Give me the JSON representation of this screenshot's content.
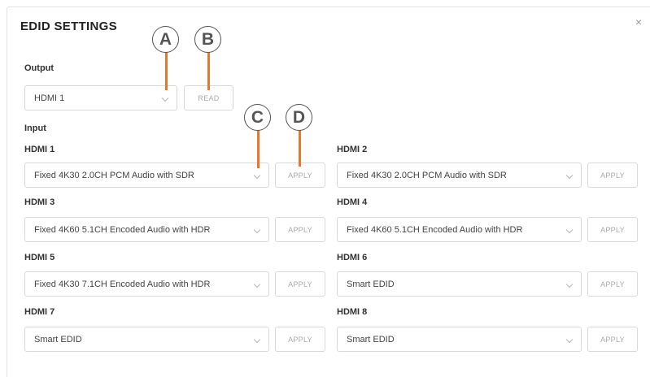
{
  "dialog": {
    "title": "EDID SETTINGS",
    "close_glyph": "×"
  },
  "output": {
    "label": "Output",
    "select_value": "HDMI 1",
    "read_label": "READ"
  },
  "input": {
    "label": "Input",
    "apply_label": "APPLY",
    "ports": [
      {
        "name": "HDMI 1",
        "value": "Fixed 4K30 2.0CH PCM Audio with SDR"
      },
      {
        "name": "HDMI 2",
        "value": "Fixed 4K30 2.0CH PCM Audio with SDR"
      },
      {
        "name": "HDMI 3",
        "value": "Fixed 4K60 5.1CH Encoded Audio with HDR"
      },
      {
        "name": "HDMI 4",
        "value": "Fixed 4K60 5.1CH Encoded Audio with HDR"
      },
      {
        "name": "HDMI 5",
        "value": "Fixed 4K30 7.1CH Encoded Audio with HDR"
      },
      {
        "name": "HDMI 6",
        "value": "Smart EDID"
      },
      {
        "name": "HDMI 7",
        "value": "Smart EDID"
      },
      {
        "name": "HDMI 8",
        "value": "Smart EDID"
      }
    ]
  },
  "callouts": {
    "a": "A",
    "b": "B",
    "c": "C",
    "d": "D"
  },
  "colors": {
    "callout_stem": "#e8772e",
    "border": "#d9d9d9"
  }
}
